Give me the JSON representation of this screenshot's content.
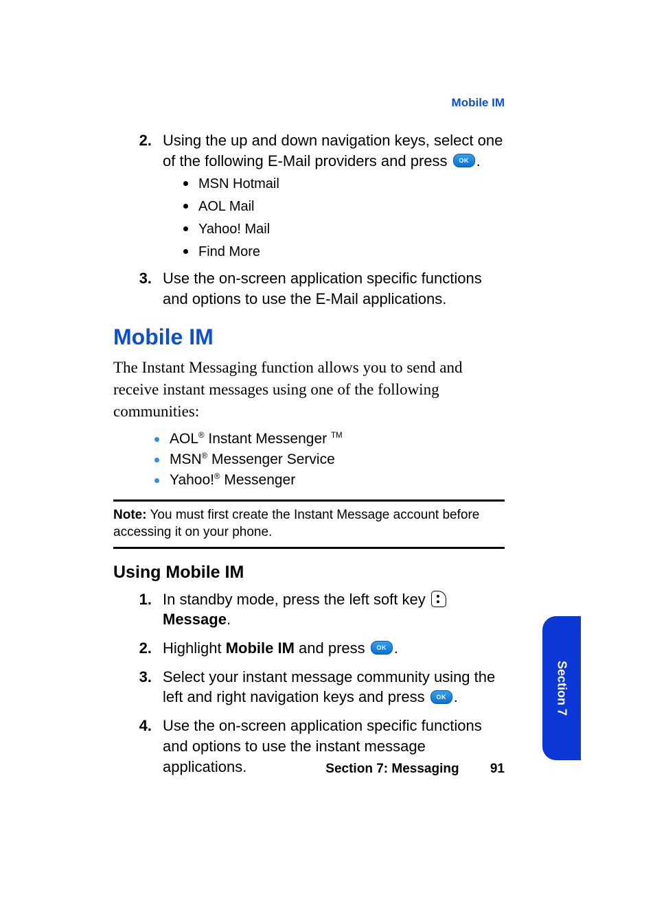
{
  "header_topic": "Mobile IM",
  "top_steps": [
    {
      "num": "2.",
      "text_before": "Using the up and down navigation keys, select one of the following E-Mail providers and press ",
      "has_ok": true,
      "text_after": ".",
      "bullets": [
        "MSN Hotmail",
        "AOL Mail",
        "Yahoo! Mail",
        "Find More"
      ]
    },
    {
      "num": "3.",
      "text_before": "Use the on-screen application specific functions and options to use the E-Mail applications.",
      "has_ok": false,
      "text_after": "",
      "bullets": []
    }
  ],
  "h1": "Mobile IM",
  "intro_para": "The Instant Messaging function allows you to send and receive instant messages using one of the following communities:",
  "im_bullets": [
    {
      "pre": "AOL",
      "sup": "®",
      "post": " Instant Messenger ",
      "tail_sup": "TM"
    },
    {
      "pre": "MSN",
      "sup": "®",
      "post": " Messenger Service",
      "tail_sup": ""
    },
    {
      "pre": "Yahoo!",
      "sup": "®",
      "post": " Messenger",
      "tail_sup": ""
    }
  ],
  "note_label": "Note:",
  "note_text": " You must first create the Instant Message account before accessing it on your phone.",
  "h2": "Using Mobile IM",
  "using_steps": [
    {
      "num": "1.",
      "parts": [
        {
          "t": "text",
          "v": "In standby mode, press the left soft key "
        },
        {
          "t": "softkey"
        },
        {
          "t": "text",
          "v": " "
        },
        {
          "t": "bold",
          "v": "Message"
        },
        {
          "t": "text",
          "v": "."
        }
      ]
    },
    {
      "num": "2.",
      "parts": [
        {
          "t": "text",
          "v": "Highlight "
        },
        {
          "t": "bold",
          "v": "Mobile IM"
        },
        {
          "t": "text",
          "v": " and press "
        },
        {
          "t": "ok"
        },
        {
          "t": "text",
          "v": "."
        }
      ]
    },
    {
      "num": "3.",
      "parts": [
        {
          "t": "text",
          "v": "Select your instant message community using the left and right navigation keys and press "
        },
        {
          "t": "ok"
        },
        {
          "t": "text",
          "v": "."
        }
      ]
    },
    {
      "num": "4.",
      "parts": [
        {
          "t": "text",
          "v": "Use the on-screen application specific functions and options to use the instant message applications."
        }
      ]
    }
  ],
  "tab_label": "Section 7",
  "footer_section": "Section 7: Messaging",
  "footer_page": "91"
}
